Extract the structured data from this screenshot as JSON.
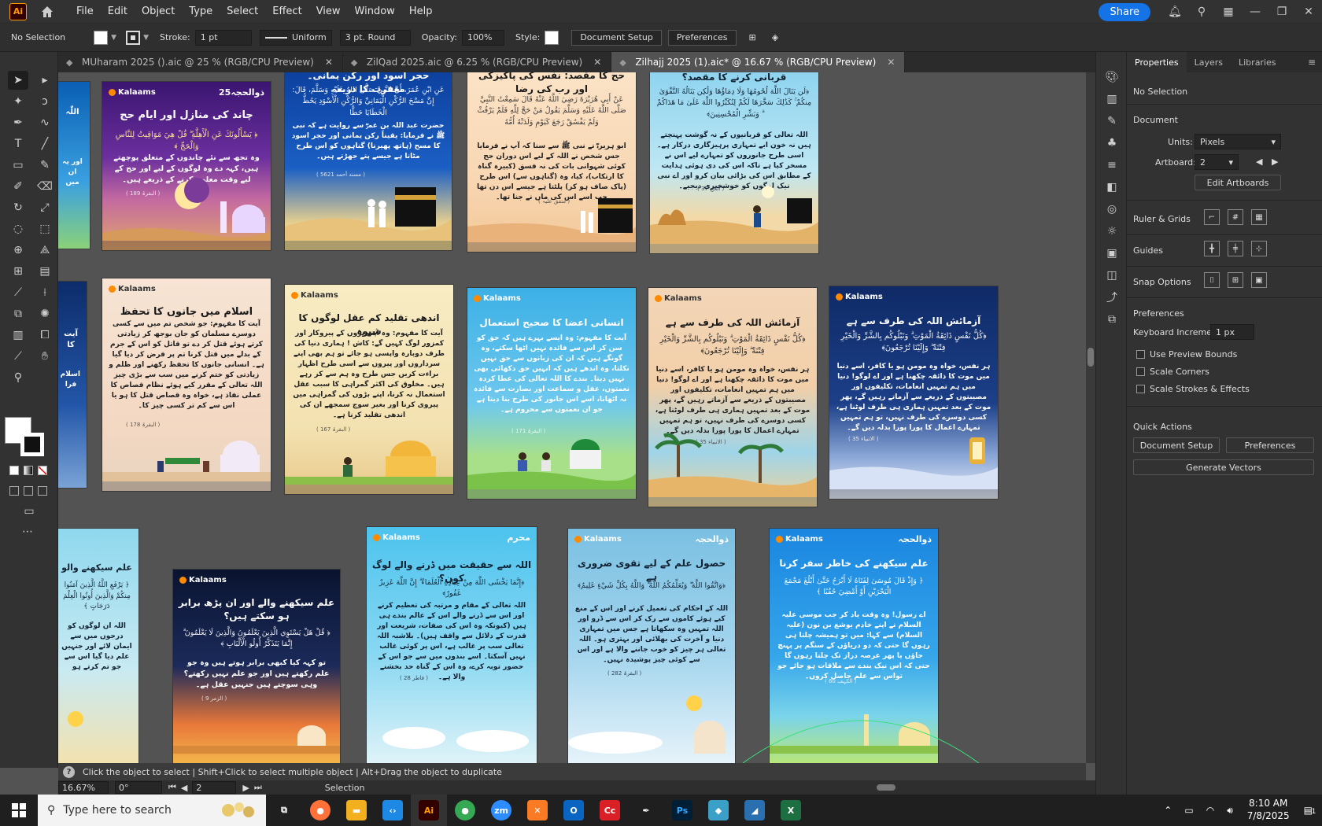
{
  "app": {
    "logo": "Ai",
    "menu": [
      "File",
      "Edit",
      "Object",
      "Type",
      "Select",
      "Effect",
      "View",
      "Window",
      "Help"
    ],
    "share_label": "Share"
  },
  "control_bar": {
    "selection": "No Selection",
    "stroke_label": "Stroke:",
    "stroke_value": "1 pt",
    "profile": "Uniform",
    "brush": "3 pt. Round",
    "opacity_label": "Opacity:",
    "opacity_value": "100%",
    "style_label": "Style:",
    "document_setup": "Document Setup",
    "preferences": "Preferences"
  },
  "tabs": [
    {
      "label": "MUharam 2025 ().aic @ 25 % (RGB/CPU Preview)",
      "active": false
    },
    {
      "label": "ZilQad 2025.aic @ 6.25 % (RGB/CPU Preview)",
      "active": false
    },
    {
      "label": "Zilhajj 2025 (1).aic* @ 16.67 % (RGB/CPU Preview)",
      "active": true
    }
  ],
  "artboards": [
    {
      "title": "",
      "arabic": "اللّٰہ",
      "body": "اور یہ ان میں",
      "brand": "",
      "badge": ""
    },
    {
      "title": "چاند کی منازل اور ایام حج",
      "arabic": "﴿ يَسْأَلُونَكَ عَنِ الْأَهِلَّةِ ۖ قُلْ هِيَ مَوَاقِيتُ لِلنَّاسِ وَالْحَجِّ ﴾",
      "body": "وہ تجھ سے نئے چاندوں کے متعلق پوچھتے ہیں، کہہ دے وہ لوگوں کے لیے اور حج کے لیے وقت معلوم کرنے کے ذریعے ہیں۔",
      "ref": "( البقرۃ 189 )",
      "brand": "Kalaams",
      "badge": "ذوالحجہ25"
    },
    {
      "title": "حجر اسود اور رکن یمانی۔ مغفرت کا ذریعہ",
      "arabic": "عَنِ ابْنِ عُمَرَ، أَنَّ النَّبِيَّ صَلَّى اللهُ عَلَيْهِ وَسَلَّمَ، قَالَ: إِنَّ مَسْحَ الرُّكْنِ الْيَمَانِيِّ وَالرُّكْنِ الْأَسْوَدِ يَحُطُّ الْخَطَايَا حَطًّا",
      "body": "حضرت عبد اللہ بن عمرؓ سے روایت ہے کہ نبی ﷺ نے فرمایا: یقیناً رکن یمانی اور حجر اسود کا مسح (ہاتھ پھیرنا) گناہوں کو اس طرح مٹاتا ہے جیسے پتے جھڑتے ہیں۔",
      "ref": "( مسند أحمد 5621 )",
      "brand": "",
      "badge": ""
    },
    {
      "title": "حج کا مقصد: نفس کی پاکیزگی اور رب کی رضا",
      "arabic": "عَنْ أَبِي هُرَيْرَةَ رَضِيَ اللَّهُ عَنْهُ قَالَ سَمِعْتُ النَّبِيَّ صَلَّى اللَّهُ عَلَيْهِ وَسَلَّمَ يَقُولُ مَنْ حَجَّ لِلَّهِ فَلَمْ يَرْفُثْ وَلَمْ يَفْسُقْ رَجَعَ كَيَوْمِ وَلَدَتْهُ أُمُّهُ",
      "body": "ابو ہریرہؓ نے نبی ﷺ سے سنا کہ آپ نے فرمایا جس شخص نے اللہ کے لیے اس دوران حج کوئی شہوانی بات کی نہ فسق (کبیرہ گناہ کا ارتکاب)، کیا، وہ (گناہوں سے) اس طرح (پاک صاف ہو کر) پلٹتا ہے جیسے اس دن تھا جب اسے اس کی ماں نے جنا تھا۔",
      "ref": "( متفق علیہ )",
      "brand": "",
      "badge": ""
    },
    {
      "title": "قربانی کرنے کا مقصد؟",
      "arabic": "﴿لَن يَنَالَ اللَّهَ لُحُومُهَا وَلَا دِمَاؤُهَا وَلَٰكِن يَنَالُهُ التَّقْوَىٰ مِنكُمْ ۚ كَذَٰلِكَ سَخَّرَهَا لَكُمْ لِتُكَبِّرُوا اللَّهَ عَلَىٰ مَا هَدَاكُمْ ۗ وَبَشِّرِ الْمُحْسِنِينَ﴾",
      "body": "اللہ تعالی کو قربانیوں کے نہ گوشت پہنچتے ہیں نہ خون ابے تمہاری پرہیزگاری درکار ہے۔ اسی طرح جانوروں کو تمہارے لیے اس نے مسخر کیا ہے تاکہ اس کی دی ہوئی ہدایت کے مطابق اس کی بڑائی بیان کرو اور اے نبی نیک لوگوں کو خوشخبری دیجیے۔",
      "ref": "( الحج 37 )",
      "brand": "",
      "badge": ""
    },
    {
      "title": "",
      "arabic": "آیت کا",
      "body": "اسلام فرا",
      "brand": "",
      "badge": ""
    },
    {
      "title": "اسلام میں جانوں کا تحفظ",
      "arabic": "",
      "body": "آیت کا مفہوم: جو شخص تم میں سے کسی دوسرے مسلمان کو جان بوجھ کر زیادتی کرتے ہوئے قتل کر دے تو قاتل کو اس کے جرم کے بدلے میں قتل کرنا تم پر فرض کر دیا گیا ہے۔ انسانی جانوں کا تحفظ رکھنے اور ظلم و زیادتی کو ختم کرنے میں سب سے بڑی چیز اللہ تعالی کے مقرر کیے ہوئے نظام قصاص کا عملی نفاذ ہے، خواہ وہ قصاص قتل کا ہو یا اس سے کم تر کسی چیز کا۔",
      "ref": "( البقرۃ 178 )",
      "brand": "Kalaams",
      "badge": ""
    },
    {
      "title": "اندھی تقلید کم عقل لوگوں کا شیوہ",
      "arabic": "",
      "body": "آیت کا مفہوم: وہ اپنے بڑوں کے پیروکار اور کمزور لوگ کہیں گے: کاش ! ہماری دنیا کی طرف دوبارہ واپسی ہو جائے تو ہم بھی اپنے سرداروں اور پیروں سے اسی طرح اظہار براءت کریں جس طرح وہ ہم سے کر رہے ہیں۔ مخلوق کی اکثر گمراہی کا سبب عقل استعمال نہ کرنا، اپنے بڑوں کی گمراہی میں پیروی کرنا اور بغیر سوچ سمجھے ان کی اندھی تقلید کرنا ہے۔",
      "ref": "( البقرۃ 167 )",
      "brand": "Kalaams",
      "badge": ""
    },
    {
      "title": "انسانی اعضا کا صحیح استعمال",
      "arabic": "",
      "body": "آیت کا مفہوم: وہ ایسے بہرے ہیں کہ حق کو سن کر اس سے فائدہ نہیں اٹھا سکتے، وہ گونگے ہیں کہ ان کی زبانوں سے حق نہیں نکلتا، وہ اندھے ہیں کہ انہیں حق دکھائی بھی نہیں دیتا۔ بندے کا اللہ تعالی کی عطا کردہ نعمتوں، عقل و سماعت اور بصارت سے فائدہ نہ اٹھانا، اسے اس جانور کی طرح بنا دیتا ہے جو ان نعمتوں سے محروم ہے۔",
      "ref": "( البقرۃ 171 )",
      "brand": "Kalaams",
      "badge": ""
    },
    {
      "title": "آزمائش اللہ کی طرف سے ہے",
      "arabic": "﴿كُلُّ نَفْسٍ ذَائِقَةُ الْمَوْتِ ۗ وَنَبْلُوكُم بِالشَّرِّ وَالْخَيْرِ فِتْنَةً ۖ وَإِلَيْنَا تُرْجَعُونَ﴾",
      "body": "ہر نفس، خواہ وہ مومن ہو یا کافر، اسے دنیا میں موت کا ذائقہ چکھنا ہے اور اے لوگو! دنیا میں ہم تمہیں انعامات، تکلیفوں اور مصیبتوں کے ذریعے سے آزماتے رہیں گے، پھر موت کے بعد تمہیں ہماری ہی طرف لوٹنا ہے، کسی دوسرے کی طرف نہیں، تو ہم تمہیں تمہارے اعمال کا پورا پورا بدلہ دیں گے۔",
      "ref": "( الانبیاء 35 )",
      "brand": "Kalaams",
      "badge": ""
    },
    {
      "title": "آزمائش اللہ کی طرف سے ہے",
      "arabic": "﴿كُلُّ نَفْسٍ ذَائِقَةُ الْمَوْتِ ۗ وَنَبْلُوكُم بِالشَّرِّ وَالْخَيْرِ فِتْنَةً ۖ وَإِلَيْنَا تُرْجَعُونَ﴾",
      "body": "ہر نفس، خواہ وہ مومن ہو یا کافر، اسے دنیا میں موت کا ذائقہ چکھنا ہے اور اے لوگو! دنیا میں ہم تمہیں انعامات، تکلیفوں اور مصیبتوں کے ذریعے سے آزماتے رہیں گے، پھر موت کے بعد تمہیں ہماری ہی طرف لوٹنا ہے، کسی دوسرے کی طرف نہیں، تو ہم تمہیں تمہارے اعمال کا پورا پورا بدلہ دیں گے۔",
      "ref": "( الانبیاء 35 )",
      "brand": "Kalaams",
      "badge": ""
    },
    {
      "title": "علم سیکھنے والو",
      "arabic": "﴿ يَرْفَعِ اللَّهُ الَّذِينَ آمَنُوا مِنكُمْ وَالَّذِينَ أُوتُوا الْعِلْمَ دَرَجَاتٍ ﴾",
      "body": "اللہ ان لوگوں کو درجوں میں سے ایمان لائے اور جنہیں علم دیا گیا اس سے جو تم کرتے ہو",
      "brand": "",
      "badge": ""
    },
    {
      "title": "علم سیکھنے والے اور ان پڑھ برابر ہو سکتے ہیں؟",
      "arabic": "﴿ قُلْ هَلْ يَسْتَوِي الَّذِينَ يَعْلَمُونَ وَالَّذِينَ لَا يَعْلَمُونَ ۗ إِنَّمَا يَتَذَكَّرُ أُولُو الْأَلْبَابِ ﴾",
      "body": "تو کہہ کیا کبھی برابر ہوتے ہیں وہ جو علم رکھتے ہیں اور جو علم نہیں رکھتے؟ وہی سوچتے ہیں جنہیں عقل ہے۔",
      "ref": "( الزمر 9 )",
      "brand": "Kalaams",
      "badge": ""
    },
    {
      "title": "اللہ سے حقیقت میں ڈرنے والے لوگ کون؟",
      "arabic": "﴿إِنَّمَا يَخْشَى اللَّهَ مِنْ عِبَادِهِ الْعُلَمَاءُ ۗ إِنَّ اللَّهَ عَزِيزٌ غَفُورٌ﴾",
      "body": "اللہ تعالی کے مقام و مرتبہ کی تعظیم کرنے اور اس سے ڈرنے والے اس کے عالم بندے ہی ہیں (کیونکہ وہ اس کی صفات، شریعت اور قدرت کے دلائل سے واقف ہیں)۔ بلاشبہ اللہ تعالی سب پر غالب ہے، اس پر کوئی غالب نہیں آسکتا۔ اسے بندوں میں سے جو اس کے حضور توبہ کرے، وہ اس کے گناہ حد بخشنے والا ہے۔",
      "ref": "( فاطر 28 )",
      "brand": "Kalaams",
      "badge": "محرم"
    },
    {
      "title": "حصول علم کے لیے تقوی ضروری ہے",
      "arabic": "﴿وَاتَّقُوا اللَّهَ ۖ وَيُعَلِّمُكُمُ اللَّهُ ۗ وَاللَّهُ بِكُلِّ شَيْءٍ عَلِيمٌ﴾",
      "body": "اللہ کے احکام کی تعمیل کرنے اور اس کے منع کیے ہوئے کاموں سے رک کر اس سے ڈرو اور اللہ تمہیں وہ سکھاتا ہے جس میں تمہاری دنیا و آخرت کی بھلائی اور بہتری ہو۔ اللہ تعالی ہر چیز کو خوب جاننے والا ہے اور اس سے کوئی چیز پوشیدہ نہیں۔",
      "ref": "( البقرۃ 282 )",
      "brand": "Kalaams",
      "badge": "ذوالحجہ"
    },
    {
      "title": "علم سیکھنے کی خاطر سفر کرنا",
      "arabic": "﴿ وَإِذْ قَالَ مُوسَىٰ لِفَتَاهُ لَا أَبْرَحُ حَتَّىٰ أَبْلُغَ مَجْمَعَ الْبَحْرَيْنِ أَوْ أَمْضِيَ حُقُبًا ﴾",
      "body": "اے رسول! وہ وقت یاد کر جب موسی علیہ السلام نے اپنے خادم یوشع بن نون (علیہ السلام) سے کہا: میں تو ہمیشہ چلتا ہی رہوں گا حتی کہ دو دریاؤں کے سنگم پر پہنچ جاؤں یا پھر عرصہ دراز تک چلتا رہوں گا حتی کہ اس نیک بندے سے ملاقات ہو جائے جو تواس سے علم حاصل کروں۔",
      "ref": "( الکہف 60 )",
      "brand": "Kalaams",
      "badge": "ذوالحجہ"
    }
  ],
  "hint_bar": {
    "icon": "?",
    "text": "Click the object to select  |  Shift+Click to select multiple object  |  Alt+Drag the object to duplicate"
  },
  "status_bar": {
    "zoom": "16.67%",
    "rotation": "0°",
    "artboard": "2",
    "mode": "Selection"
  },
  "properties": {
    "tabs": [
      "Properties",
      "Layers",
      "Libraries"
    ],
    "no_selection": "No Selection",
    "document": "Document",
    "units_label": "Units:",
    "units_value": "Pixels",
    "artboard_label": "Artboard:",
    "artboard_value": "2",
    "edit_artboards": "Edit Artboards",
    "rulers_grids": "Ruler & Grids",
    "guides": "Guides",
    "snap_options": "Snap Options",
    "preferences": "Preferences",
    "keyboard_increment_label": "Keyboard Increment:",
    "keyboard_increment_value": "1 px",
    "checks": [
      "Use Preview Bounds",
      "Scale Corners",
      "Scale Strokes & Effects"
    ],
    "quick_actions": "Quick Actions",
    "qa_document_setup": "Document Setup",
    "qa_preferences": "Preferences",
    "qa_generate_vectors": "Generate Vectors"
  },
  "taskbar": {
    "search_placeholder": "Type here to search",
    "time": "8:10 AM",
    "date": "7/8/2025",
    "notification_count": "1",
    "apps": [
      {
        "name": "task-view",
        "label": "⧉",
        "color": "#1f1f1f"
      },
      {
        "name": "firefox",
        "label": "●",
        "color": "#ff7139"
      },
      {
        "name": "file-explorer",
        "label": "▬",
        "color": "#f2b01e"
      },
      {
        "name": "vscode",
        "label": "‹›",
        "color": "#1e88e5"
      },
      {
        "name": "illustrator",
        "label": "Ai",
        "color": "#330000"
      },
      {
        "name": "chrome",
        "label": "●",
        "color": "#34a853"
      },
      {
        "name": "zoom",
        "label": "zm",
        "color": "#2d8cff"
      },
      {
        "name": "xampp",
        "label": "✕",
        "color": "#fb7a24"
      },
      {
        "name": "outlook",
        "label": "O",
        "color": "#0a64c2"
      },
      {
        "name": "creative-cloud",
        "label": "Cc",
        "color": "#da1f26"
      },
      {
        "name": "pen-tool",
        "label": "✒",
        "color": "#1f1f1f"
      },
      {
        "name": "photoshop",
        "label": "Ps",
        "color": "#001e36"
      },
      {
        "name": "app-3d",
        "label": "◆",
        "color": "#3aa0c8"
      },
      {
        "name": "app-notes",
        "label": "◢",
        "color": "#2a6fb0"
      },
      {
        "name": "excel",
        "label": "X",
        "color": "#1d6f42"
      }
    ]
  },
  "colors": {
    "accent": "#1473e6",
    "chrome_dark": "#323232",
    "canvas": "#535353"
  }
}
